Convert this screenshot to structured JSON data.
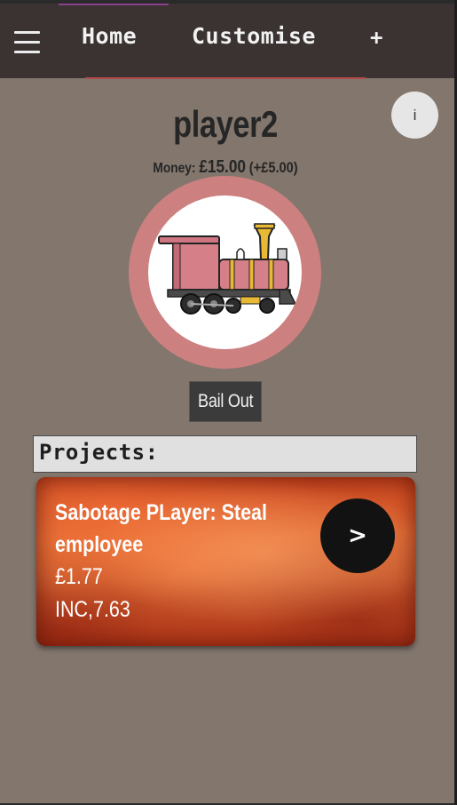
{
  "nav": {
    "menu_icon": "hamburger-menu-icon",
    "home_label": "Home",
    "customise_label": "Customise",
    "add_label": "+"
  },
  "info_button": {
    "label": "i"
  },
  "player": {
    "name": "player2",
    "money_label": "Money:",
    "money_value": "£15.00",
    "money_delta": "(+£5.00)",
    "avatar_icon": "steam-train-icon"
  },
  "bail_out": {
    "label": "Bail Out"
  },
  "projects": {
    "header": "Projects:",
    "items": [
      {
        "title": "Sabotage PLayer: Steal employee",
        "cost": "£1.77",
        "income": "INC,7.63",
        "action_label": ">"
      }
    ]
  },
  "colors": {
    "page_background": "#82766d",
    "navbar_background": "#3a3331",
    "avatar_ring": "#cd8080",
    "card_orange": "#e06a33",
    "button_dark": "#121212"
  }
}
